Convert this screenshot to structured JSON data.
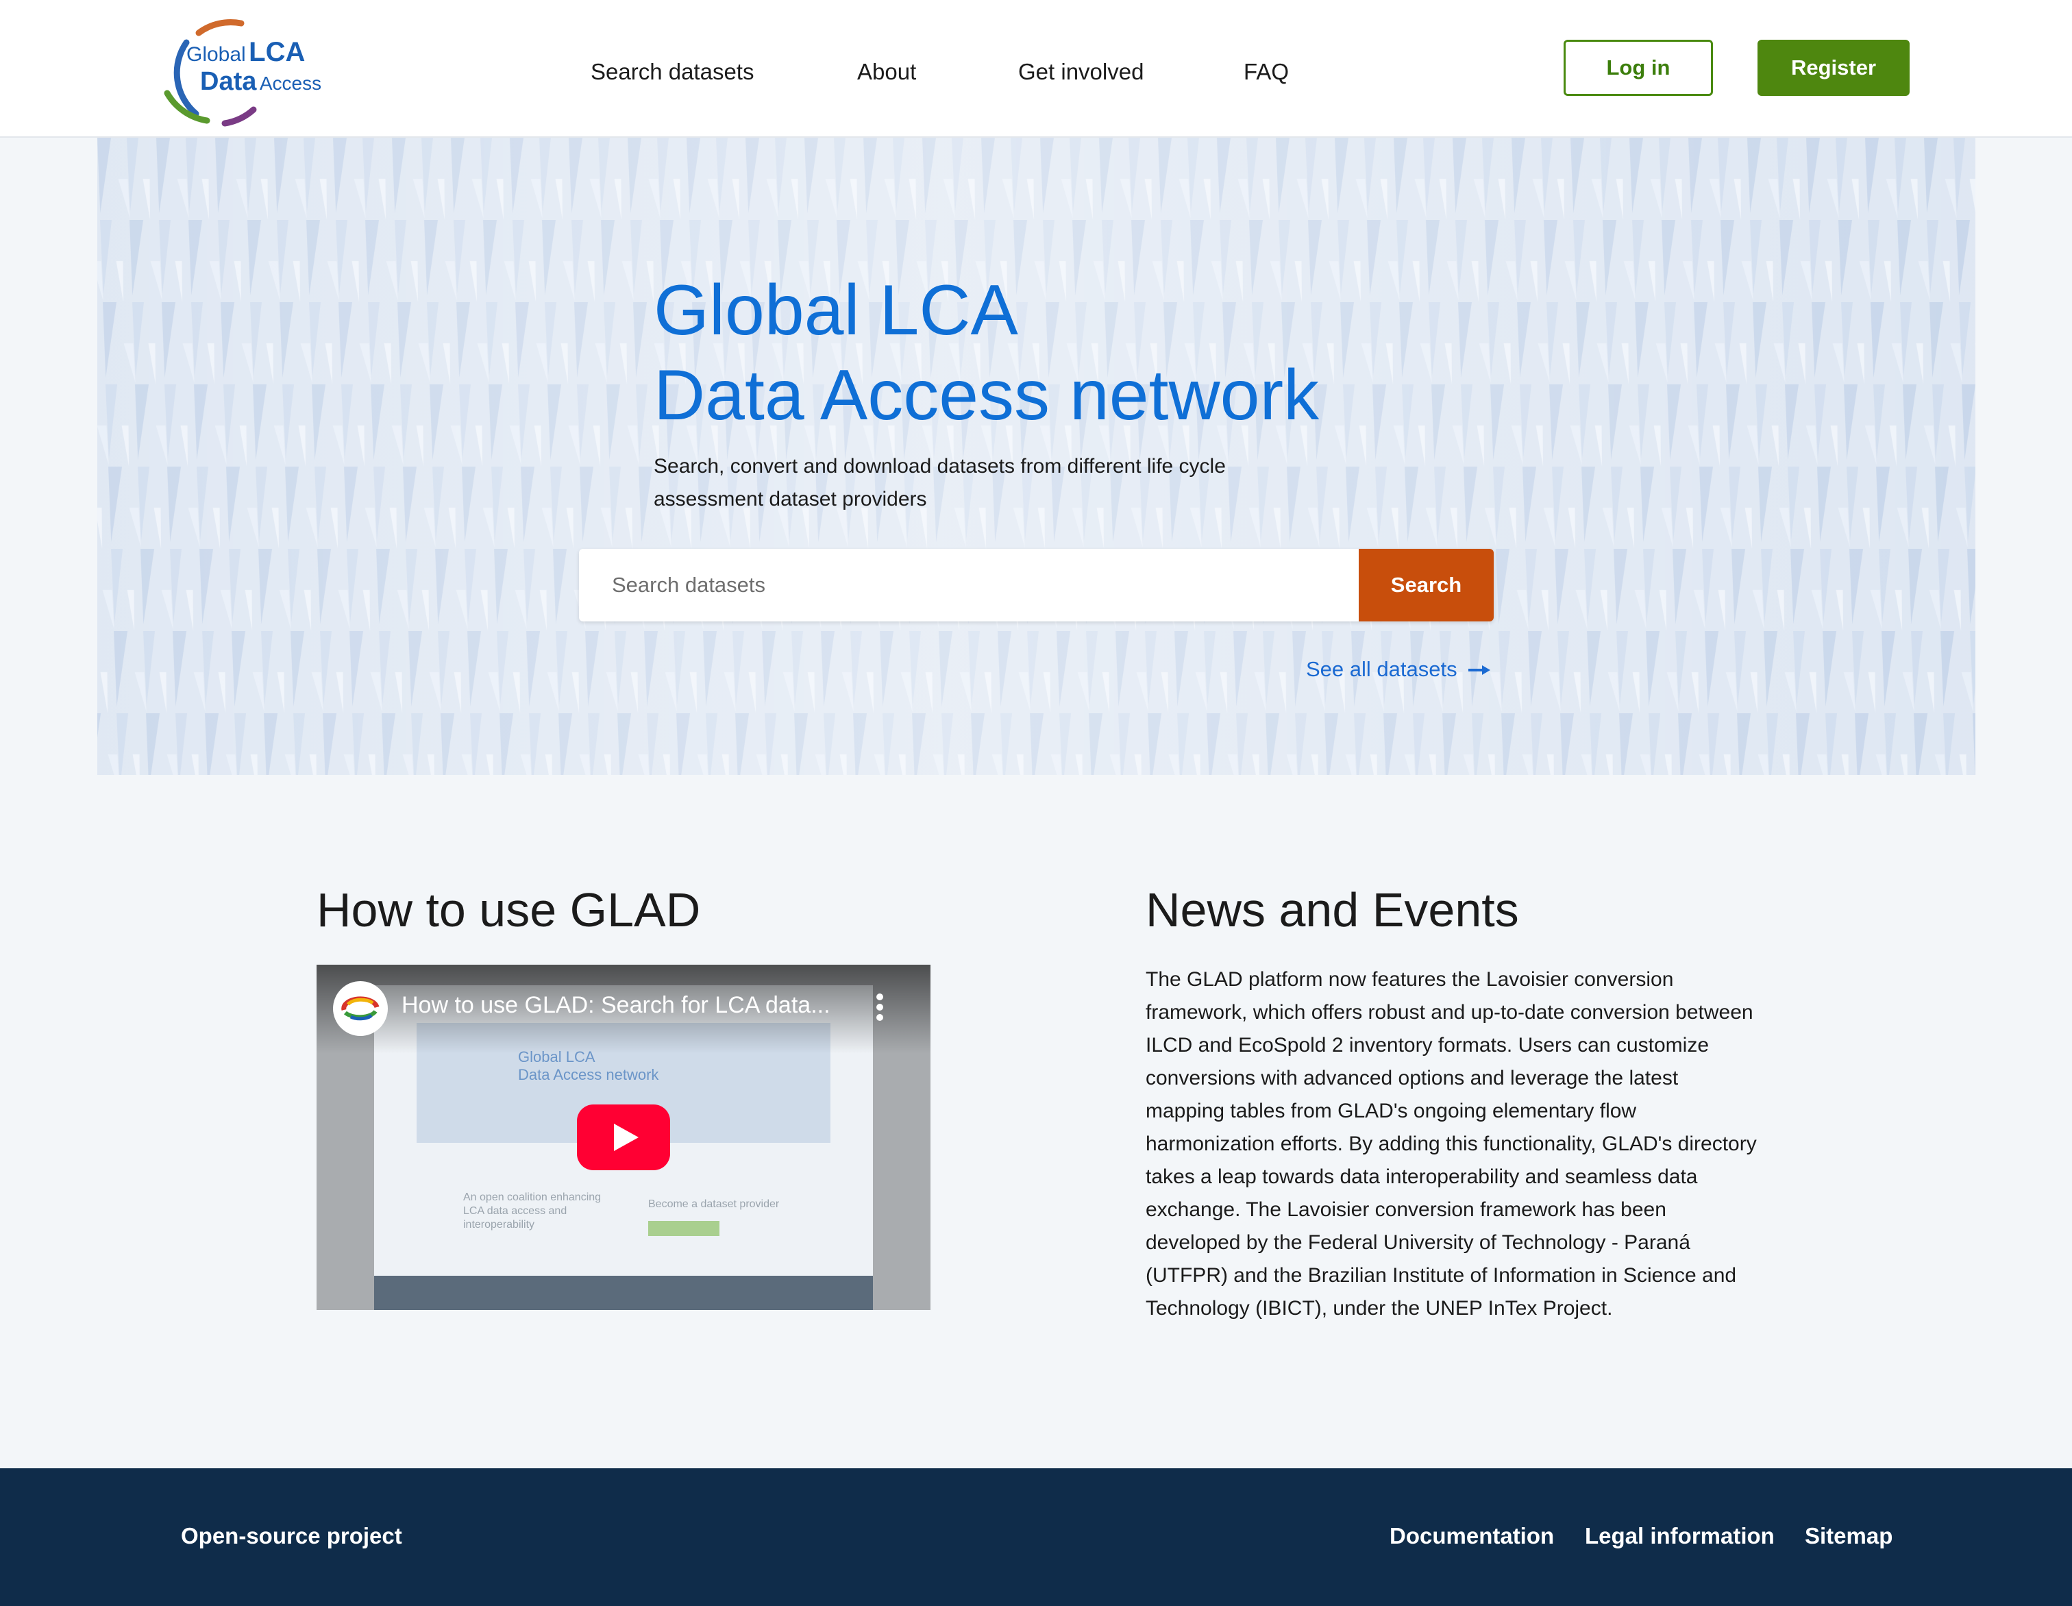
{
  "logo": {
    "line1_small": "Global",
    "line1_big": "LCA",
    "line2_big": "Data",
    "line2_small": "Access",
    "ring_colors": [
      "#2a65b5",
      "#d06a2c",
      "#5a9a2e",
      "#7a3b85"
    ]
  },
  "nav": {
    "items": [
      {
        "label": "Search datasets"
      },
      {
        "label": "About"
      },
      {
        "label": "Get involved"
      },
      {
        "label": "FAQ"
      }
    ]
  },
  "auth": {
    "login_label": "Log in",
    "register_label": "Register"
  },
  "hero": {
    "title_line1": "Global LCA",
    "title_line2": "Data Access network",
    "subtitle": "Search, convert and download datasets from different life cycle assessment dataset providers",
    "search_placeholder": "Search datasets",
    "search_button": "Search",
    "see_all_link": "See all datasets",
    "see_all_icon": "arrow-right-icon"
  },
  "how_to": {
    "title": "How to use GLAD",
    "video": {
      "title": "How to use GLAD: Search for LCA data...",
      "play_icon": "youtube-play-icon",
      "menu_icon": "kebab-menu-icon",
      "preview_title_line1": "Global LCA",
      "preview_title_line2": "Data Access network",
      "preview_left_heading": "An open coalition enhancing LCA data access and interoperability",
      "preview_right_heading": "Become a dataset provider"
    }
  },
  "news": {
    "title": "News and Events",
    "body": "The GLAD platform now features the Lavoisier conversion framework, which offers robust and up-to-date conversion between ILCD and EcoSpold 2 inventory formats. Users can customize conversions with advanced options and leverage the latest mapping tables from GLAD's ongoing elementary flow harmonization efforts. By adding this functionality, GLAD's directory takes a leap towards data interoperability and seamless data exchange. The Lavoisier conversion framework has been developed by the Federal University of Technology - Paraná (UTFPR) and the Brazilian Institute of Information in Science and Technology (IBICT), under the UNEP InTex Project."
  },
  "footer": {
    "left_link": "Open-source project",
    "links": [
      {
        "label": "Documentation"
      },
      {
        "label": "Legal information"
      },
      {
        "label": "Sitemap"
      }
    ]
  },
  "colors": {
    "accent_blue": "#0f6fd6",
    "brand_green": "#4e870f",
    "search_orange": "#c84e0c",
    "footer_navy": "#0f2c4a"
  }
}
